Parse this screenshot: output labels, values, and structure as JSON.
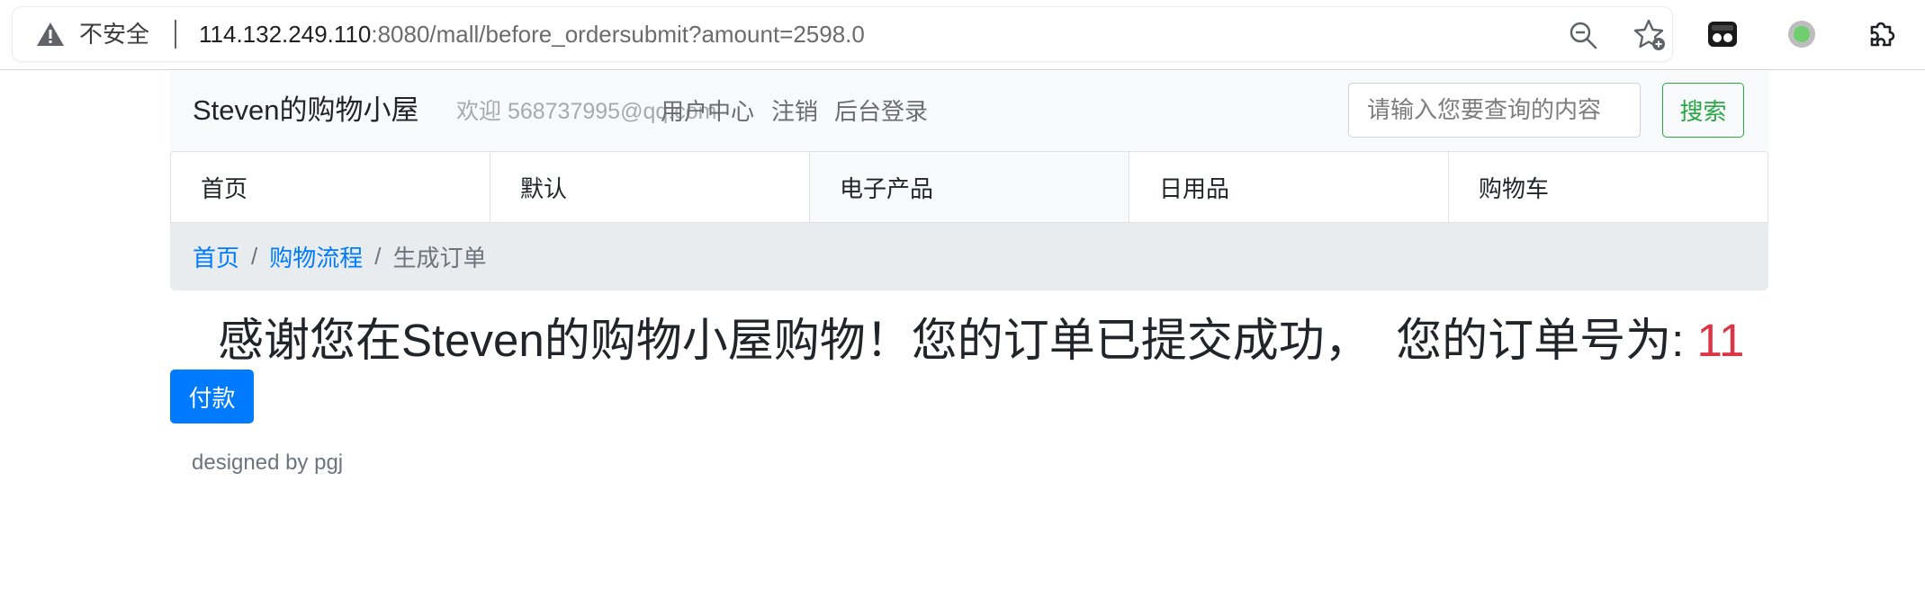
{
  "browser": {
    "security_label": "不安全",
    "url_host": "114.132.249.110",
    "url_rest": ":8080/mall/before_ordersubmit?amount=2598.0",
    "icons": [
      "warning-icon",
      "zoom-out-icon",
      "star-add-icon",
      "extension-icon",
      "extension-status-icon",
      "puzzle-icon"
    ]
  },
  "navbar": {
    "brand": "Steven的购物小屋",
    "welcome": "欢迎 568737995@qq.com",
    "links": [
      {
        "label": "用户中心"
      },
      {
        "label": "注销"
      },
      {
        "label": "后台登录"
      }
    ],
    "search_placeholder": "请输入您要查询的内容",
    "search_button": "搜索"
  },
  "tabs": [
    {
      "label": "首页"
    },
    {
      "label": "默认"
    },
    {
      "label": "电子产品"
    },
    {
      "label": "日用品"
    },
    {
      "label": "购物车"
    }
  ],
  "breadcrumb": {
    "items": [
      "首页",
      "购物流程"
    ],
    "separator": "/",
    "active": "生成订单"
  },
  "message": {
    "text": "感谢您在Steven的购物小屋购物！您的订单已提交成功，  您的订单号为: ",
    "order_no": "11"
  },
  "pay_button": "付款",
  "footer": "designed by pgj",
  "colors": {
    "link": "#007bff",
    "success": "#28a745",
    "danger": "#dc3545",
    "navbar_bg": "#f8f9fa",
    "breadcrumb_bg": "#e9ecef"
  }
}
